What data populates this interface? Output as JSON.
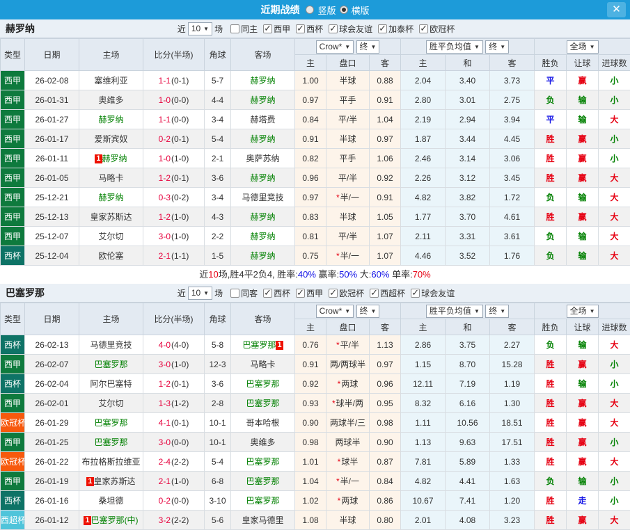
{
  "titlebar": {
    "title": "近期战绩",
    "radio_vertical": "竖版",
    "radio_horizontal": "横版",
    "close_icon": "✕"
  },
  "filter": {
    "near_label": "近",
    "count": "10",
    "matches_label": "场"
  },
  "table_header": {
    "cols": [
      "类型",
      "日期",
      "主场",
      "比分(半场)",
      "角球",
      "客场"
    ],
    "sub_cols": [
      "主",
      "盘口",
      "客",
      "主",
      "和",
      "客",
      "胜负",
      "让球",
      "进球数"
    ],
    "dropdown_company": "Crow*",
    "dropdown_final1": "终",
    "dropdown_mean": "胜平负均值",
    "dropdown_final2": "终",
    "dropdown_scope": "全场"
  },
  "league_colors": {
    "西甲": "#0e7a3d",
    "西杯": "#0e7366",
    "欧冠杯": "#f7590d",
    "西超杯": "#4fc4da"
  },
  "status_colors": {
    "win_red": "#e60012",
    "lose_green": "#008000",
    "draw_blue": "#1414e6",
    "score_red": "#e6003c",
    "titlebar_blue": "#1d9bd9"
  },
  "sections": [
    {
      "team": "赫罗纳",
      "same": {
        "label": "同主",
        "checked": false
      },
      "leagues": [
        {
          "label": "西甲",
          "checked": true
        },
        {
          "label": "西杯",
          "checked": true
        },
        {
          "label": "球会友谊",
          "checked": true
        },
        {
          "label": "加泰杯",
          "checked": true
        },
        {
          "label": "欧冠杯",
          "checked": true
        }
      ],
      "rows": [
        {
          "league": "西甲",
          "date": "26-02-08",
          "home": {
            "name": "塞维利亚"
          },
          "score": "1-1",
          "half": "(0-1)",
          "corner": "5-7",
          "away": {
            "name": "赫罗纳",
            "green": true
          },
          "h_odds": "1.00",
          "handicap": "半球",
          "star": false,
          "a_odds": "0.88",
          "m_home": "2.04",
          "m_draw": "3.40",
          "m_away": "3.73",
          "result": {
            "t": "平",
            "c": "blue"
          },
          "let_result": {
            "t": "赢",
            "c": "red"
          },
          "goal_result": {
            "t": "小",
            "c": "green"
          }
        },
        {
          "league": "西甲",
          "date": "26-01-31",
          "home": {
            "name": "奥维多"
          },
          "score": "1-0",
          "half": "(0-0)",
          "corner": "4-4",
          "away": {
            "name": "赫罗纳",
            "green": true
          },
          "h_odds": "0.97",
          "handicap": "平手",
          "star": false,
          "a_odds": "0.91",
          "m_home": "2.80",
          "m_draw": "3.01",
          "m_away": "2.75",
          "result": {
            "t": "负",
            "c": "green"
          },
          "let_result": {
            "t": "输",
            "c": "green"
          },
          "goal_result": {
            "t": "小",
            "c": "green"
          }
        },
        {
          "league": "西甲",
          "date": "26-01-27",
          "home": {
            "name": "赫罗纳",
            "green": true
          },
          "score": "1-1",
          "half": "(0-0)",
          "corner": "3-4",
          "away": {
            "name": "赫塔费"
          },
          "h_odds": "0.84",
          "handicap": "平/半",
          "star": false,
          "a_odds": "1.04",
          "m_home": "2.19",
          "m_draw": "2.94",
          "m_away": "3.94",
          "result": {
            "t": "平",
            "c": "blue"
          },
          "let_result": {
            "t": "输",
            "c": "green"
          },
          "goal_result": {
            "t": "大",
            "c": "red"
          }
        },
        {
          "league": "西甲",
          "date": "26-01-17",
          "home": {
            "name": "爱斯宾奴"
          },
          "score": "0-2",
          "half": "(0-1)",
          "corner": "5-4",
          "away": {
            "name": "赫罗纳",
            "green": true
          },
          "h_odds": "0.91",
          "handicap": "半球",
          "star": false,
          "a_odds": "0.97",
          "m_home": "1.87",
          "m_draw": "3.44",
          "m_away": "4.45",
          "result": {
            "t": "胜",
            "c": "red"
          },
          "let_result": {
            "t": "赢",
            "c": "red"
          },
          "goal_result": {
            "t": "小",
            "c": "green"
          }
        },
        {
          "league": "西甲",
          "date": "26-01-11",
          "home": {
            "name": "赫罗纳",
            "green": true,
            "badge": {
              "text": "1",
              "pos": "before"
            }
          },
          "score": "1-0",
          "half": "(1-0)",
          "corner": "2-1",
          "away": {
            "name": "奥萨苏纳"
          },
          "h_odds": "0.82",
          "handicap": "平手",
          "star": false,
          "a_odds": "1.06",
          "m_home": "2.46",
          "m_draw": "3.14",
          "m_away": "3.06",
          "result": {
            "t": "胜",
            "c": "red"
          },
          "let_result": {
            "t": "赢",
            "c": "red"
          },
          "goal_result": {
            "t": "小",
            "c": "green"
          }
        },
        {
          "league": "西甲",
          "date": "26-01-05",
          "home": {
            "name": "马略卡"
          },
          "score": "1-2",
          "half": "(0-1)",
          "corner": "3-6",
          "away": {
            "name": "赫罗纳",
            "green": true
          },
          "h_odds": "0.96",
          "handicap": "平/半",
          "star": false,
          "a_odds": "0.92",
          "m_home": "2.26",
          "m_draw": "3.12",
          "m_away": "3.45",
          "result": {
            "t": "胜",
            "c": "red"
          },
          "let_result": {
            "t": "赢",
            "c": "red"
          },
          "goal_result": {
            "t": "大",
            "c": "red"
          }
        },
        {
          "league": "西甲",
          "date": "25-12-21",
          "home": {
            "name": "赫罗纳",
            "green": true
          },
          "score": "0-3",
          "half": "(0-2)",
          "corner": "3-4",
          "away": {
            "name": "马德里竞技"
          },
          "h_odds": "0.97",
          "handicap": "半/一",
          "star": true,
          "a_odds": "0.91",
          "m_home": "4.82",
          "m_draw": "3.82",
          "m_away": "1.72",
          "result": {
            "t": "负",
            "c": "green"
          },
          "let_result": {
            "t": "输",
            "c": "green"
          },
          "goal_result": {
            "t": "大",
            "c": "red"
          }
        },
        {
          "league": "西甲",
          "date": "25-12-13",
          "home": {
            "name": "皇家苏斯达"
          },
          "score": "1-2",
          "half": "(1-0)",
          "corner": "4-3",
          "away": {
            "name": "赫罗纳",
            "green": true
          },
          "h_odds": "0.83",
          "handicap": "半球",
          "star": false,
          "a_odds": "1.05",
          "m_home": "1.77",
          "m_draw": "3.70",
          "m_away": "4.61",
          "result": {
            "t": "胜",
            "c": "red"
          },
          "let_result": {
            "t": "赢",
            "c": "red"
          },
          "goal_result": {
            "t": "大",
            "c": "red"
          }
        },
        {
          "league": "西甲",
          "date": "25-12-07",
          "home": {
            "name": "艾尔切"
          },
          "score": "3-0",
          "half": "(1-0)",
          "corner": "2-2",
          "away": {
            "name": "赫罗纳",
            "green": true
          },
          "h_odds": "0.81",
          "handicap": "平/半",
          "star": false,
          "a_odds": "1.07",
          "m_home": "2.11",
          "m_draw": "3.31",
          "m_away": "3.61",
          "result": {
            "t": "负",
            "c": "green"
          },
          "let_result": {
            "t": "输",
            "c": "green"
          },
          "goal_result": {
            "t": "大",
            "c": "red"
          }
        },
        {
          "league": "西杯",
          "date": "25-12-04",
          "home": {
            "name": "欧伦塞"
          },
          "score": "2-1",
          "half": "(1-1)",
          "corner": "1-5",
          "away": {
            "name": "赫罗纳",
            "green": true
          },
          "h_odds": "0.75",
          "handicap": "半/一",
          "star": true,
          "a_odds": "1.07",
          "m_home": "4.46",
          "m_draw": "3.52",
          "m_away": "1.76",
          "result": {
            "t": "负",
            "c": "green"
          },
          "let_result": {
            "t": "输",
            "c": "green"
          },
          "goal_result": {
            "t": "大",
            "c": "red"
          }
        }
      ],
      "summary": [
        {
          "t": "近"
        },
        {
          "t": "10",
          "c": "red"
        },
        {
          "t": "场,胜4平2负4, 胜率:"
        },
        {
          "t": "40%",
          "c": "blue"
        },
        {
          "t": " 赢率:"
        },
        {
          "t": "50%",
          "c": "blue"
        },
        {
          "t": " 大:"
        },
        {
          "t": "60%",
          "c": "blue"
        },
        {
          "t": " 单率:"
        },
        {
          "t": "70%",
          "c": "red"
        }
      ]
    },
    {
      "team": "巴塞罗那",
      "same": {
        "label": "同客",
        "checked": false
      },
      "leagues": [
        {
          "label": "西杯",
          "checked": true
        },
        {
          "label": "西甲",
          "checked": true
        },
        {
          "label": "欧冠杯",
          "checked": true
        },
        {
          "label": "西超杯",
          "checked": true
        },
        {
          "label": "球会友谊",
          "checked": true
        }
      ],
      "rows": [
        {
          "league": "西杯",
          "date": "26-02-13",
          "home": {
            "name": "马德里竞技"
          },
          "score": "4-0",
          "half": "(4-0)",
          "corner": "5-8",
          "away": {
            "name": "巴塞罗那",
            "green": true,
            "badge": {
              "text": "1",
              "pos": "after"
            }
          },
          "h_odds": "0.76",
          "handicap": "平/半",
          "star": true,
          "a_odds": "1.13",
          "m_home": "2.86",
          "m_draw": "3.75",
          "m_away": "2.27",
          "result": {
            "t": "负",
            "c": "green"
          },
          "let_result": {
            "t": "输",
            "c": "green"
          },
          "goal_result": {
            "t": "大",
            "c": "red"
          }
        },
        {
          "league": "西甲",
          "date": "26-02-07",
          "home": {
            "name": "巴塞罗那",
            "green": true
          },
          "score": "3-0",
          "half": "(1-0)",
          "corner": "12-3",
          "away": {
            "name": "马略卡"
          },
          "h_odds": "0.91",
          "handicap": "两/两球半",
          "star": false,
          "a_odds": "0.97",
          "m_home": "1.15",
          "m_draw": "8.70",
          "m_away": "15.28",
          "result": {
            "t": "胜",
            "c": "red"
          },
          "let_result": {
            "t": "赢",
            "c": "red"
          },
          "goal_result": {
            "t": "小",
            "c": "green"
          }
        },
        {
          "league": "西杯",
          "date": "26-02-04",
          "home": {
            "name": "阿尔巴塞特"
          },
          "score": "1-2",
          "half": "(0-1)",
          "corner": "3-6",
          "away": {
            "name": "巴塞罗那",
            "green": true
          },
          "h_odds": "0.92",
          "handicap": "两球",
          "star": true,
          "a_odds": "0.96",
          "m_home": "12.11",
          "m_draw": "7.19",
          "m_away": "1.19",
          "result": {
            "t": "胜",
            "c": "red"
          },
          "let_result": {
            "t": "输",
            "c": "green"
          },
          "goal_result": {
            "t": "小",
            "c": "green"
          }
        },
        {
          "league": "西甲",
          "date": "26-02-01",
          "home": {
            "name": "艾尔切"
          },
          "score": "1-3",
          "half": "(1-2)",
          "corner": "2-8",
          "away": {
            "name": "巴塞罗那",
            "green": true
          },
          "h_odds": "0.93",
          "handicap": "球半/两",
          "star": true,
          "a_odds": "0.95",
          "m_home": "8.32",
          "m_draw": "6.16",
          "m_away": "1.30",
          "result": {
            "t": "胜",
            "c": "red"
          },
          "let_result": {
            "t": "赢",
            "c": "red"
          },
          "goal_result": {
            "t": "大",
            "c": "red"
          }
        },
        {
          "league": "欧冠杯",
          "date": "26-01-29",
          "home": {
            "name": "巴塞罗那",
            "green": true
          },
          "score": "4-1",
          "half": "(0-1)",
          "corner": "10-1",
          "away": {
            "name": "哥本哈根"
          },
          "h_odds": "0.90",
          "handicap": "两球半/三",
          "star": false,
          "a_odds": "0.98",
          "m_home": "1.11",
          "m_draw": "10.56",
          "m_away": "18.51",
          "result": {
            "t": "胜",
            "c": "red"
          },
          "let_result": {
            "t": "赢",
            "c": "red"
          },
          "goal_result": {
            "t": "大",
            "c": "red"
          }
        },
        {
          "league": "西甲",
          "date": "26-01-25",
          "home": {
            "name": "巴塞罗那",
            "green": true
          },
          "score": "3-0",
          "half": "(0-0)",
          "corner": "10-1",
          "away": {
            "name": "奥维多"
          },
          "h_odds": "0.98",
          "handicap": "两球半",
          "star": false,
          "a_odds": "0.90",
          "m_home": "1.13",
          "m_draw": "9.63",
          "m_away": "17.51",
          "result": {
            "t": "胜",
            "c": "red"
          },
          "let_result": {
            "t": "赢",
            "c": "red"
          },
          "goal_result": {
            "t": "小",
            "c": "green"
          }
        },
        {
          "league": "欧冠杯",
          "date": "26-01-22",
          "home": {
            "name": "布拉格斯拉维亚"
          },
          "score": "2-4",
          "half": "(2-2)",
          "corner": "5-4",
          "away": {
            "name": "巴塞罗那",
            "green": true
          },
          "h_odds": "1.01",
          "handicap": "球半",
          "star": true,
          "a_odds": "0.87",
          "m_home": "7.81",
          "m_draw": "5.89",
          "m_away": "1.33",
          "result": {
            "t": "胜",
            "c": "red"
          },
          "let_result": {
            "t": "赢",
            "c": "red"
          },
          "goal_result": {
            "t": "大",
            "c": "red"
          }
        },
        {
          "league": "西甲",
          "date": "26-01-19",
          "home": {
            "name": "皇家苏斯达",
            "badge": {
              "text": "1",
              "pos": "before"
            }
          },
          "score": "2-1",
          "half": "(1-0)",
          "corner": "6-8",
          "away": {
            "name": "巴塞罗那",
            "green": true
          },
          "h_odds": "1.04",
          "handicap": "半/一",
          "star": true,
          "a_odds": "0.84",
          "m_home": "4.82",
          "m_draw": "4.41",
          "m_away": "1.63",
          "result": {
            "t": "负",
            "c": "green"
          },
          "let_result": {
            "t": "输",
            "c": "green"
          },
          "goal_result": {
            "t": "小",
            "c": "green"
          }
        },
        {
          "league": "西杯",
          "date": "26-01-16",
          "home": {
            "name": "桑坦德"
          },
          "score": "0-2",
          "half": "(0-0)",
          "corner": "3-10",
          "away": {
            "name": "巴塞罗那",
            "green": true
          },
          "h_odds": "1.02",
          "handicap": "两球",
          "star": true,
          "a_odds": "0.86",
          "m_home": "10.67",
          "m_draw": "7.41",
          "m_away": "1.20",
          "result": {
            "t": "胜",
            "c": "red"
          },
          "let_result": {
            "t": "走",
            "c": "blue"
          },
          "goal_result": {
            "t": "小",
            "c": "green"
          }
        },
        {
          "league": "西超杯",
          "date": "26-01-12",
          "home": {
            "name": "巴塞罗那(中)",
            "green": true,
            "badge": {
              "text": "1",
              "pos": "before"
            }
          },
          "score": "3-2",
          "half": "(2-2)",
          "corner": "5-6",
          "away": {
            "name": "皇家马德里"
          },
          "h_odds": "1.08",
          "handicap": "半球",
          "star": false,
          "a_odds": "0.80",
          "m_home": "2.01",
          "m_draw": "4.08",
          "m_away": "3.23",
          "result": {
            "t": "胜",
            "c": "red"
          },
          "let_result": {
            "t": "赢",
            "c": "red"
          },
          "goal_result": {
            "t": "大",
            "c": "red"
          }
        }
      ]
    }
  ]
}
